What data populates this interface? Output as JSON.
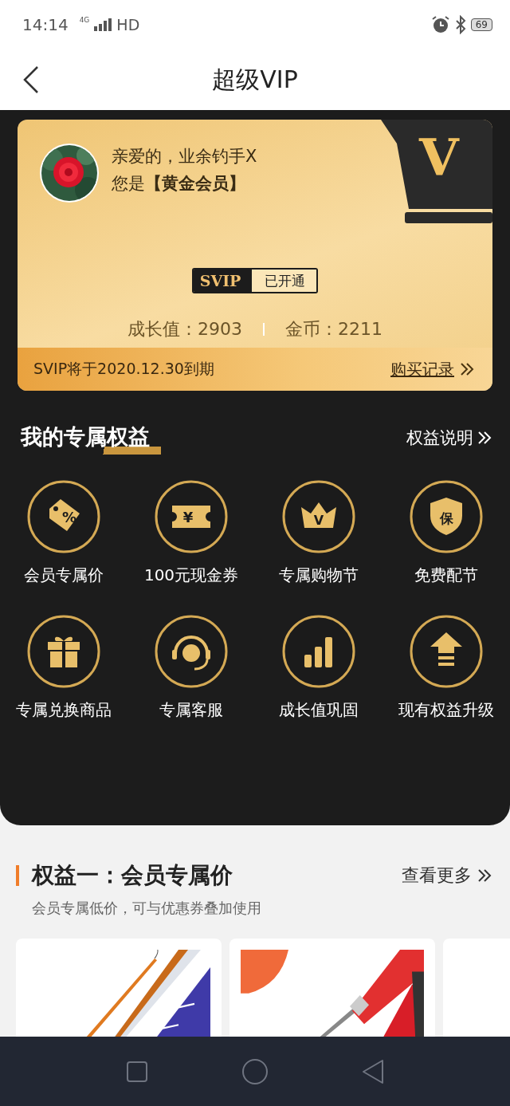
{
  "status_bar": {
    "time": "14:14",
    "network": "4G",
    "hd": "HD",
    "battery": "69"
  },
  "header": {
    "title": "超级VIP"
  },
  "member_card": {
    "greeting": "亲爱的，业余钓手X",
    "level": "您是**【黄金会员】**",
    "crown_letter": "V",
    "badge": {
      "brand": "SVIP",
      "status": "已开通"
    },
    "stats": [
      "成长值：2903",
      "金币：2211"
    ],
    "expiry": "SVIP将于2020.12.30到期",
    "link": "购买记录"
  },
  "benefits": {
    "title": "我的专属权益",
    "link": "权益说明",
    "items": [
      {
        "kind": "percent",
        "glyph": "%",
        "label": "会员专属价"
      },
      {
        "kind": "coupon",
        "glyph": "¥",
        "label": "100元现金券"
      },
      {
        "kind": "crown",
        "glyph": "V",
        "label": "专属购物节"
      },
      {
        "kind": "shield",
        "glyph": "保",
        "label": "免费配节"
      },
      {
        "kind": "gift",
        "label": "专属兑换商品"
      },
      {
        "kind": "headset",
        "label": "专属客服"
      },
      {
        "kind": "bars",
        "label": "成长值巩固"
      },
      {
        "kind": "upgrade",
        "label": "现有权益升级"
      }
    ]
  },
  "section": {
    "title": "权益一：会员专属价",
    "subtitle": "会员专属低价，可与优惠券叠加使用",
    "link": "查看更多",
    "products": [
      {
        "kind": "picture"
      },
      {
        "kind": "picture"
      },
      {
        "kind": "empty"
      }
    ]
  }
}
